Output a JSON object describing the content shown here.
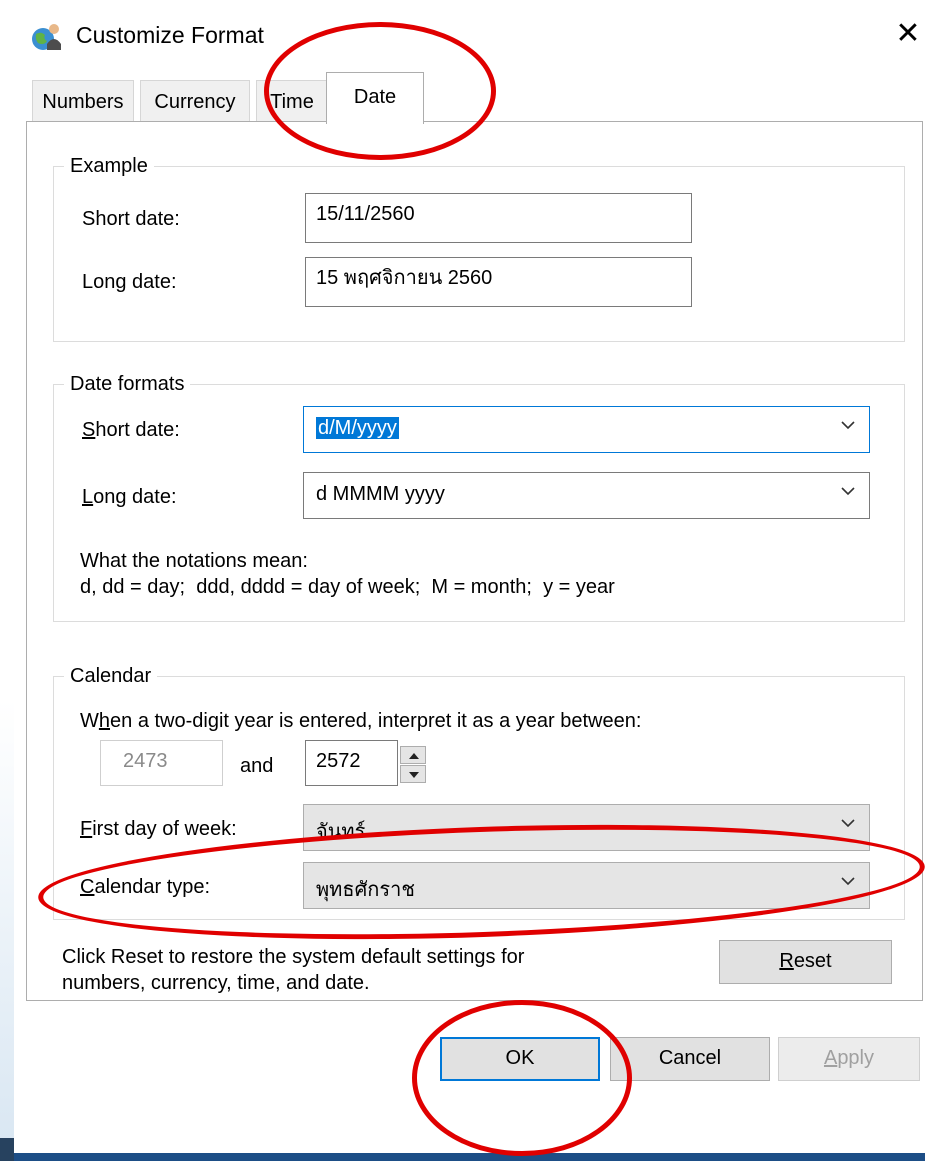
{
  "window": {
    "title": "Customize Format",
    "icon": "globe-people-icon",
    "close_label": "✕"
  },
  "tabs": [
    {
      "label": "Numbers"
    },
    {
      "label": "Currency"
    },
    {
      "label": "Time"
    },
    {
      "label": "Date",
      "active": true
    }
  ],
  "example": {
    "legend": "Example",
    "short_label": "Short date:",
    "short_value": "15/11/2560",
    "long_label": "Long date:",
    "long_value": "15 พฤศจิกายน 2560"
  },
  "formats": {
    "legend": "Date formats",
    "short_label_key": "S",
    "short_label_rest": "hort date:",
    "short_value": "d/M/yyyy",
    "long_label_key": "L",
    "long_label_rest": "ong date:",
    "long_value": "d MMMM yyyy",
    "notations_title": "What the notations mean:",
    "notations_text": "d, dd = day;  ddd, dddd = day of week;  M = month;  y = year"
  },
  "calendar": {
    "legend": "Calendar",
    "two_digit_pre": "W",
    "two_digit_key": "h",
    "two_digit_rest": "en a two-digit year is entered, interpret it as a year between:",
    "year_from": "2473",
    "and_label": "and",
    "year_to": "2572",
    "first_day_key": "F",
    "first_day_rest": "irst day of week:",
    "first_day_value": "จันทร์",
    "calendar_type_key": "C",
    "calendar_type_rest": "alendar type:",
    "calendar_type_value": "พุทธศักราช"
  },
  "reset": {
    "text_line1": "Click Reset to restore the system default settings for",
    "text_line2": "numbers, currency, time, and date.",
    "button_key": "R",
    "button_rest": "eset"
  },
  "buttons": {
    "ok": "OK",
    "cancel": "Cancel",
    "apply_key": "A",
    "apply_rest": "pply"
  },
  "colors": {
    "annotation": "#e00000",
    "accent": "#0078d7",
    "selection": "#0078d7"
  }
}
